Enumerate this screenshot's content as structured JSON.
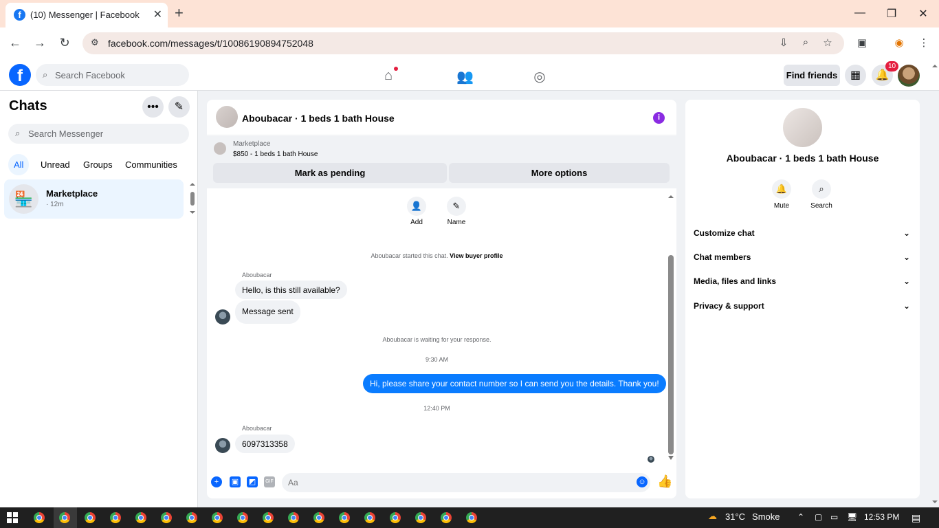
{
  "browser": {
    "tab_title": "(10) Messenger | Facebook",
    "url": "facebook.com/messages/t/10086190894752048"
  },
  "fb": {
    "search_placeholder": "Search Facebook",
    "find_friends": "Find friends",
    "notification_count": "10"
  },
  "chats": {
    "title": "Chats",
    "search_placeholder": "Search Messenger",
    "filters": [
      "All",
      "Unread",
      "Groups",
      "Communities"
    ],
    "items": [
      {
        "name": "Marketplace",
        "time": "· 12m"
      }
    ]
  },
  "conversation": {
    "title": "Aboubacar · 1 beds 1 bath House",
    "marketplace_label": "Marketplace",
    "listing": "$850 - 1 beds 1 bath House",
    "mark_pending": "Mark as pending",
    "more_options": "More options",
    "tools": [
      {
        "label": "Add"
      },
      {
        "label": "Name"
      }
    ],
    "started_text": "Aboubacar started this chat.",
    "view_buyer_profile": "View buyer profile",
    "sender_name": "Aboubacar",
    "msg1": "Hello, is this still available?",
    "msg2": "Message sent",
    "waiting": "Aboubacar is waiting for your response.",
    "time1": "9:30 AM",
    "outgoing": "Hi, please share your contact number so I can send you the details. Thank you!",
    "time2": "12:40 PM",
    "sender_name2": "Aboubacar",
    "msg3": "6097313358",
    "input_placeholder": "Aa"
  },
  "details": {
    "name": "Aboubacar · 1 beds 1 bath House",
    "mute": "Mute",
    "search": "Search",
    "sections": [
      "Customize chat",
      "Chat members",
      "Media, files and links",
      "Privacy & support"
    ]
  },
  "taskbar": {
    "temperature": "31°C",
    "weather": "Smoke",
    "time": "12:53 PM"
  },
  "colors": {
    "accent": "#0866ff",
    "outgoing_bubble": "#0a7cff",
    "selected_bg": "#ebf5ff",
    "titlebar": "#fde3d6"
  }
}
